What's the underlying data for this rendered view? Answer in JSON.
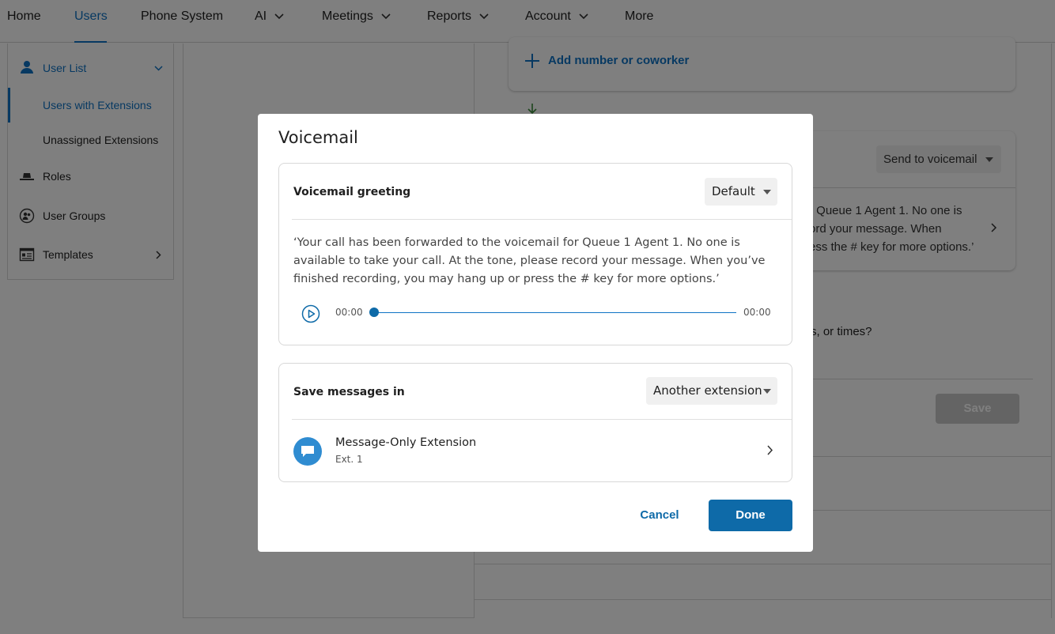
{
  "nav": {
    "items": [
      {
        "label": "Home",
        "dropdown": false
      },
      {
        "label": "Users",
        "dropdown": false,
        "active": true
      },
      {
        "label": "Phone System",
        "dropdown": false
      },
      {
        "label": "AI",
        "dropdown": true
      },
      {
        "label": "Meetings",
        "dropdown": true
      },
      {
        "label": "Reports",
        "dropdown": true
      },
      {
        "label": "Account",
        "dropdown": true
      },
      {
        "label": "More",
        "dropdown": false
      }
    ]
  },
  "sidebar": {
    "items": [
      {
        "label": "User List",
        "icon": "user-list-icon",
        "expanded": true
      },
      {
        "label": "Users with Extensions",
        "selected": true
      },
      {
        "label": "Unassigned Extensions"
      },
      {
        "label": "Roles",
        "icon": "roles-hat-icon"
      },
      {
        "label": "User Groups",
        "icon": "user-groups-icon"
      },
      {
        "label": "Templates",
        "icon": "templates-icon"
      }
    ]
  },
  "background": {
    "add_number_label": "Add number or coworker",
    "send_to_voicemail_label": "Send to voicemail",
    "greeting_fragment": [
      "r Queue 1 Agent 1. No one is",
      "ord your message. When",
      "ess the # key for more options.’"
    ],
    "question_fragment": "s, or times?",
    "save_label": "Save"
  },
  "modal": {
    "title": "Voicemail",
    "greeting_panel": {
      "heading": "Voicemail greeting",
      "select_value": "Default",
      "greeting_text": "‘Your call has been forwarded to the voicemail for Queue 1 Agent 1. No one is available to take your call. At the tone, please record your message. When you’ve finished recording, you may hang up or press the # key for more options.’",
      "player": {
        "current_time": "00:00",
        "total_time": "00:00",
        "progress": 0
      }
    },
    "save_panel": {
      "heading": "Save messages in",
      "select_value": "Another extension",
      "extension_name": "Message-Only Extension",
      "extension_number": "Ext. 1"
    },
    "cancel_label": "Cancel",
    "done_label": "Done"
  },
  "colors": {
    "accent": "#0e72c4",
    "primary_button": "#0e6aa8",
    "overlay": "rgba(0,0,0,0.5)"
  }
}
